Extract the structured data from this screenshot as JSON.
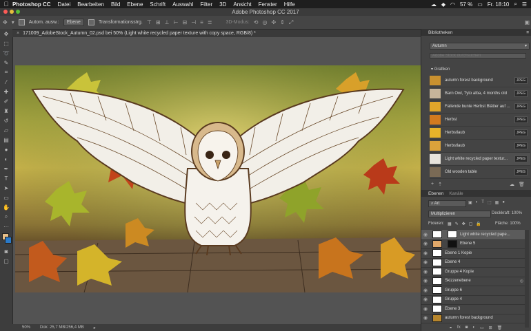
{
  "menubar": {
    "apple_icon": "apple-logo",
    "app_name": "Photoshop CC",
    "items": [
      "Datei",
      "Bearbeiten",
      "Bild",
      "Ebene",
      "Schrift",
      "Auswahl",
      "Filter",
      "3D",
      "Ansicht",
      "Fenster",
      "Hilfe"
    ],
    "battery": "57 %",
    "clock": "Fr. 18:10"
  },
  "window": {
    "title": "Adobe Photoshop CC 2017"
  },
  "options": {
    "auto_select_label": "Autom. ausw.:",
    "auto_select_value": "Ebene",
    "transform_label": "Transformationsstrg.",
    "mode_3d_label": "3D-Modus:"
  },
  "document": {
    "tab_title": "171009_AdobeStock_Autumn_02.psd bei 50% (Light white recycled paper texture with copy space, RGB/8) *",
    "zoom": "50%",
    "doc_info": "Dok: 25,7 MB/256,4 MB"
  },
  "libraries": {
    "panel_title": "Bibliotheken",
    "library_name": "Autumn",
    "search_placeholder": "Adobe Stock durchsuchen",
    "section_title": "Grafiken",
    "items": [
      {
        "label": "autumn forest background",
        "badge": "JPEG",
        "color": "#c9912f"
      },
      {
        "label": "Barn Owl, Tyto alba, 4 months old",
        "badge": "JPEG",
        "color": "#c7b59a"
      },
      {
        "label": "Fallende bunte Herbst Blätter auf ...",
        "badge": "JPEG",
        "color": "#e0a52a"
      },
      {
        "label": "Herbst",
        "badge": "JPEG",
        "color": "#d27a1f"
      },
      {
        "label": "Herbstlaub",
        "badge": "JPEG",
        "color": "#e7b32a"
      },
      {
        "label": "Herbstlaub",
        "badge": "JPEG",
        "color": "#dca23b"
      },
      {
        "label": "Light white recycled paper textur...",
        "badge": "JPEG",
        "color": "#e8e4dc"
      },
      {
        "label": "Old wooden table",
        "badge": "JPEG",
        "color": "#7a6a55"
      }
    ]
  },
  "layers": {
    "tab_layers": "Ebenen",
    "tab_channels": "Kanäle",
    "filter_kind": "Art",
    "blend_mode": "Multiplizieren",
    "opacity_label": "Deckkraft:",
    "opacity_value": "100%",
    "lock_label": "Fixieren:",
    "fill_label": "Fläche:",
    "fill_value": "100%",
    "items": [
      {
        "name": "Light white recycled pape...",
        "type": "image"
      },
      {
        "name": "Ebene 5",
        "type": "mask"
      },
      {
        "name": "Ebene 1 Kopie",
        "type": "image"
      },
      {
        "name": "Ebene 4",
        "type": "image"
      },
      {
        "name": "Gruppe 4 Kopie",
        "type": "image"
      },
      {
        "name": "Skizzenebene",
        "type": "image"
      },
      {
        "name": "Gruppe 6",
        "type": "image"
      },
      {
        "name": "Gruppe 4",
        "type": "image"
      },
      {
        "name": "Ebene 3",
        "type": "image"
      },
      {
        "name": "autumn forest background",
        "type": "image"
      }
    ]
  }
}
